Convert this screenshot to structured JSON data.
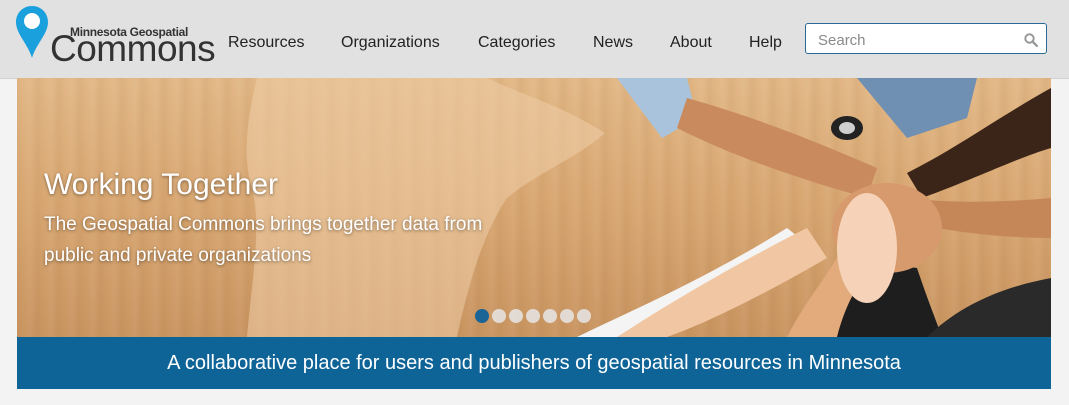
{
  "logo": {
    "subtitle": "Minnesota Geospatial",
    "wordmark": "Commons",
    "icon": "map-pin-icon"
  },
  "nav": {
    "items": [
      "Resources",
      "Organizations",
      "Categories",
      "News",
      "About",
      "Help"
    ]
  },
  "search": {
    "placeholder": "Search",
    "icon": "search-icon"
  },
  "hero": {
    "title": "Working Together",
    "text": "The Geospatial Commons brings together data from public and private organizations",
    "slide_count": 7,
    "active_slide": 1
  },
  "banner": {
    "text": "A collaborative place for users and publishers of geospatial resources in Minnesota"
  },
  "colors": {
    "accent": "#0f6497",
    "pin": "#1aa0dc",
    "header_bg": "#e1e1e1"
  }
}
